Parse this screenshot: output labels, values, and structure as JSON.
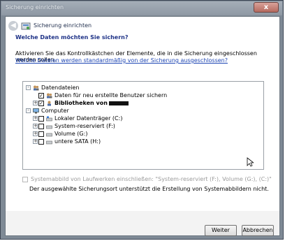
{
  "window": {
    "title": "Sicherung einrichten",
    "close_label": "x"
  },
  "header": {
    "title": "Sicherung einrichten"
  },
  "main": {
    "question": "Welche Daten möchten Sie sichern?",
    "description": "Aktivieren Sie das Kontrollkästchen der Elemente, die in die Sicherung eingeschlossen werden sollen.",
    "link": "Welche Dateien werden standardmäßig von der Sicherung ausgeschlossen?"
  },
  "tree": {
    "datendateien": {
      "label": "Datendateien",
      "expanded": true
    },
    "new_users": {
      "label": "Daten für neu erstellte Benutzer sichern",
      "checked": true
    },
    "libraries": {
      "label": "Bibliotheken von",
      "checked": true
    },
    "computer": {
      "label": "Computer",
      "expanded": true
    },
    "drives": [
      {
        "label": "Lokaler Datenträger (C:)",
        "checked": false
      },
      {
        "label": "System-reserviert (F:)",
        "checked": false
      },
      {
        "label": "Volume (G:)",
        "checked": false
      },
      {
        "label": "untere SATA (H:)",
        "checked": false
      }
    ]
  },
  "system_image": {
    "label": "Systemabbild von Laufwerken einschließen: \"System-reserviert (F:), Volume (G:), (C:)\"",
    "checked": false,
    "enabled": false
  },
  "notice": "Der ausgewählte Sicherungsort unterstützt die Erstellung von Systemabbildern nicht.",
  "buttons": {
    "next": "Weiter",
    "cancel": "Abbrechen"
  },
  "colors": {
    "title_text": "#1e3287",
    "link": "#1e46b4",
    "disabled_text": "#9b9b9b"
  }
}
